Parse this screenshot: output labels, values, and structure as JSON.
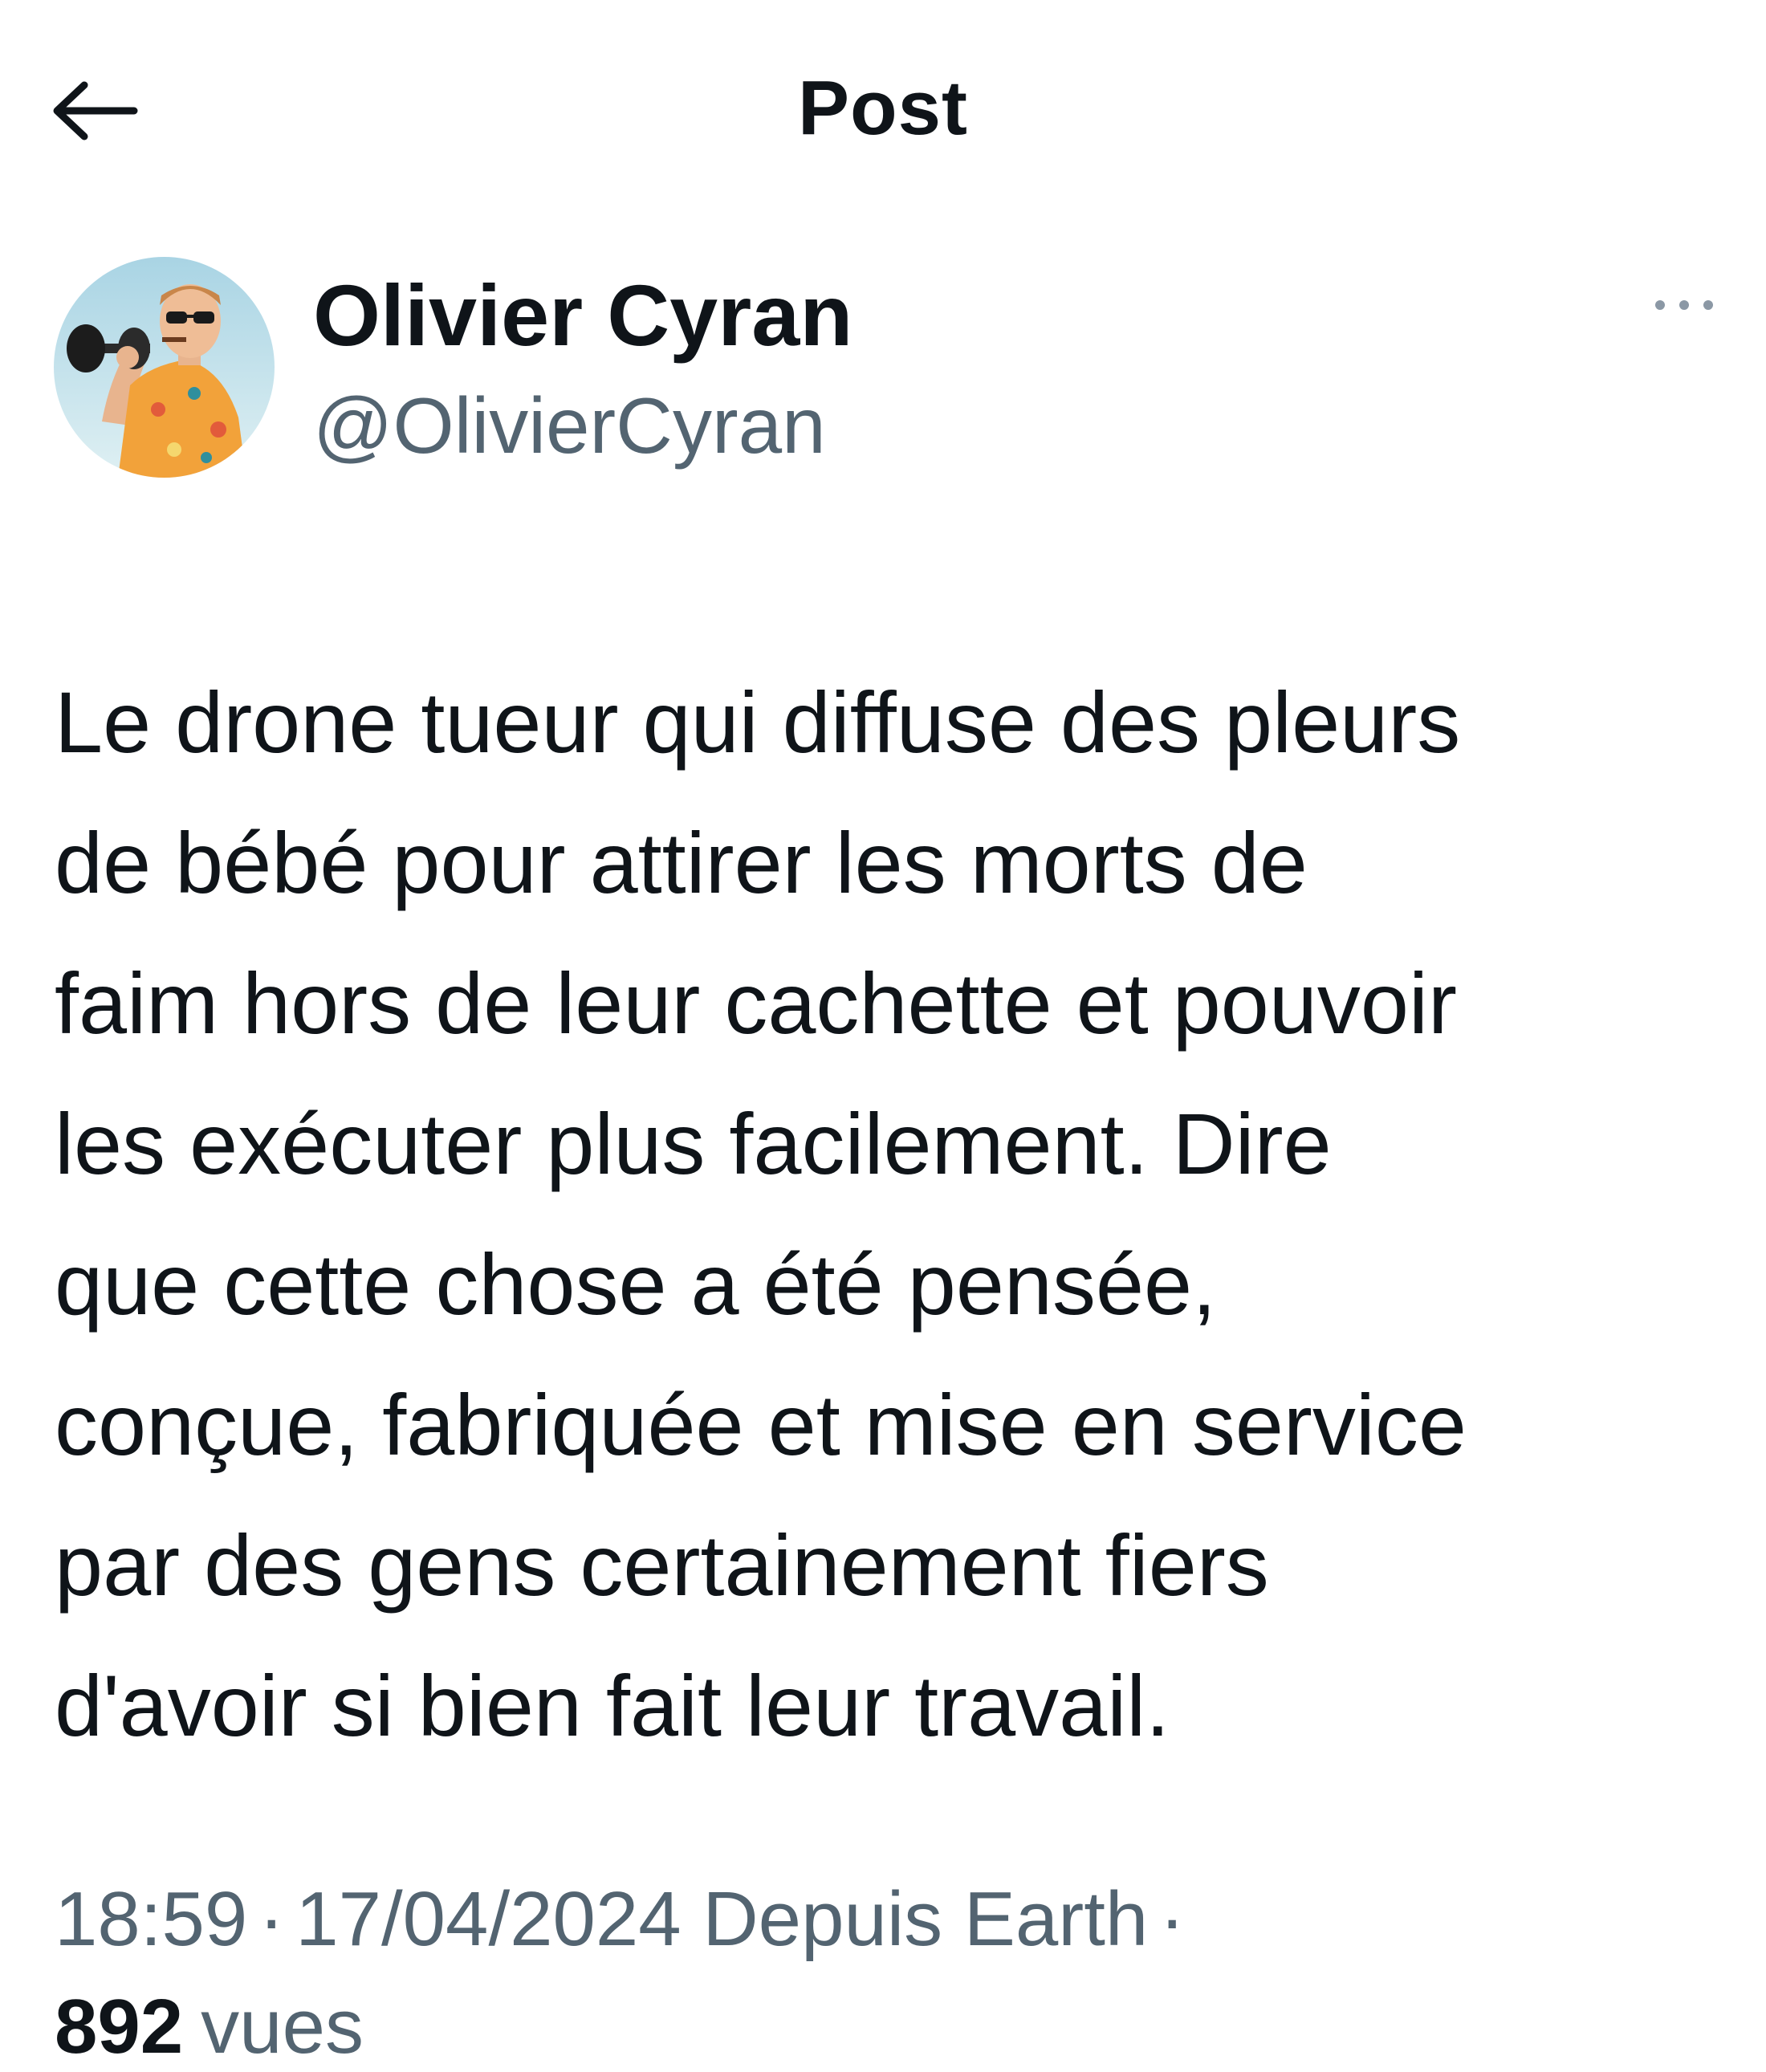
{
  "header": {
    "title": "Post",
    "back_icon": "arrow-left-icon"
  },
  "author": {
    "display_name": "Olivier Cyran",
    "handle": "@OlivierCyran",
    "avatar_icon": "avatar",
    "more_icon": "more-horizontal-icon"
  },
  "post": {
    "text": "Le drone tueur qui diffuse des pleurs\nde bébé pour attirer les morts de\nfaim hors de leur cachette et pouvoir\nles exécuter plus facilement. Dire\nque cette chose a été pensée,\nconçue, fabriquée et mise en service\npar des gens certainement fiers\nd'avoir si bien fait leur travail.",
    "time": "18:59",
    "separator": "·",
    "date": "17/04/2024",
    "source": "Depuis Earth",
    "views_count": "892",
    "views_label": "vues"
  },
  "colors": {
    "text_primary": "#0f1419",
    "text_secondary": "#536471",
    "background": "#ffffff"
  }
}
